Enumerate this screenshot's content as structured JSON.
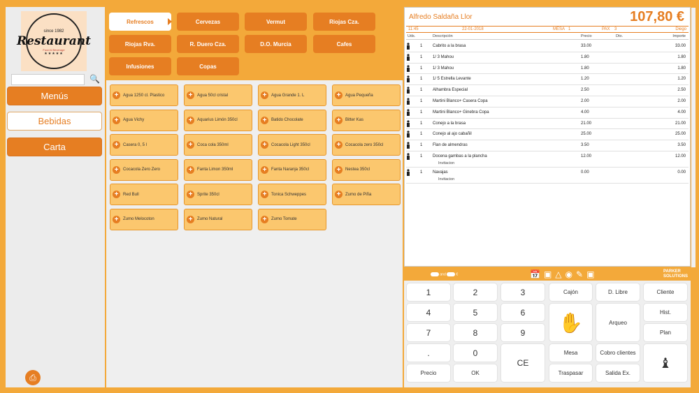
{
  "left": {
    "logo": {
      "since": "since 1982",
      "brand": "Restaurant",
      "tag": "Food & Beverage",
      "stars": "★★★★★"
    },
    "nav": [
      "Menús",
      "Bebidas",
      "Carta"
    ],
    "active_nav": "Bebidas"
  },
  "categories": [
    "Refrescos",
    "Cervezas",
    "Vermut",
    "Riojas Cza.",
    "Riojas Rva.",
    "R. Duero Cza.",
    "D.O. Murcia",
    "Cafes",
    "Infusiones",
    "Copas"
  ],
  "products": [
    "Agua 1250 cl. Plastico",
    "Agua 50cl cristal",
    "Agua Grande 1. L",
    "Agua Pequeña",
    "Agua Vichy",
    "Aquarius Limón 350cl",
    "Batido Chocolate",
    "Bitter Kas",
    "Casera 0, 5 l",
    "Coca cola 350ml",
    "Cocacola Light 350cl",
    "Cocacola zero 350cl",
    "Cocacola Zero Zero",
    "Fanta Limon 350ml",
    "Fanta Naranja 350cl",
    "Nestea 350cl",
    "Red Bull",
    "Sprite 350cl",
    "Tonica Schweppes",
    "Zumo de Piña",
    "Zumo Melocoton",
    "Zumo Natural",
    "Zumo Tomate"
  ],
  "ticket": {
    "customer": "Alfredo Saldaña Llor",
    "total": "107,80 €",
    "time": "11:45",
    "date": "22-01-2018",
    "mesa_label": "MESA",
    "mesa": "1",
    "pax_label": "PAX",
    "pax": "3",
    "waiter": "Diego",
    "headers": {
      "uds": "Uds.",
      "desc": "Descripción",
      "precio": "Precio",
      "dto": "Dto.",
      "importe": "Importe"
    },
    "lines": [
      {
        "uds": "1",
        "desc": "Cabrito a la brasa",
        "precio": "33.00",
        "importe": "33.00",
        "note": ""
      },
      {
        "uds": "1",
        "desc": "1/ 3 Mahou",
        "precio": "1.80",
        "importe": "1.80",
        "note": ""
      },
      {
        "uds": "1",
        "desc": "1/ 3 Mahou",
        "precio": "1.80",
        "importe": "1.80",
        "note": ""
      },
      {
        "uds": "1",
        "desc": "1/ 5 Estrella Levante",
        "precio": "1.20",
        "importe": "1.20",
        "note": ""
      },
      {
        "uds": "1",
        "desc": "Alhambra Especial",
        "precio": "2.50",
        "importe": "2.50",
        "note": ""
      },
      {
        "uds": "1",
        "desc": "Martini Blanco+ Casera Copa",
        "precio": "2.00",
        "importe": "2.00",
        "note": ""
      },
      {
        "uds": "1",
        "desc": "Martini Blanco+ Ginebra Copa",
        "precio": "4.00",
        "importe": "4.00",
        "note": ""
      },
      {
        "uds": "1",
        "desc": "Conejo a la brasa",
        "precio": "21.00",
        "importe": "21.00",
        "note": ""
      },
      {
        "uds": "1",
        "desc": "Conejo al ajo cabañil",
        "precio": "25.00",
        "importe": "25.00",
        "note": ""
      },
      {
        "uds": "1",
        "desc": "Flan de almendras",
        "precio": "3.50",
        "importe": "3.50",
        "note": ""
      },
      {
        "uds": "1",
        "desc": "Docena gambas a la plancha",
        "precio": "12.00",
        "importe": "12.00",
        "note": "Invitacion"
      },
      {
        "uds": "1",
        "desc": "Navajas",
        "precio": "0.00",
        "importe": "0.00",
        "note": "Invitacion"
      }
    ]
  },
  "padbar": {
    "toggle": "and",
    "currency": "€",
    "brand": "PARKER",
    "brand_sub": "SOLUTIONS"
  },
  "keypad": {
    "digits": [
      "1",
      "2",
      "3",
      "4",
      "5",
      "6",
      "7",
      "8",
      "9",
      ".",
      "0"
    ],
    "ce": "CE",
    "precio": "Precio",
    "ok": "OK",
    "cajon": "Cajón",
    "dlibre": "D. Libre",
    "cliente": "Cliente",
    "hist": "Hist.",
    "arqueo": "Arqueo",
    "plan": "Plan",
    "mesa": "Mesa",
    "cobro": "Cobro clientes",
    "traspasar": "Traspasar",
    "salida": "Salida Ex."
  },
  "colors": {
    "accent": "#e67e22",
    "background": "#f3a93a",
    "product": "#fbc76e"
  }
}
